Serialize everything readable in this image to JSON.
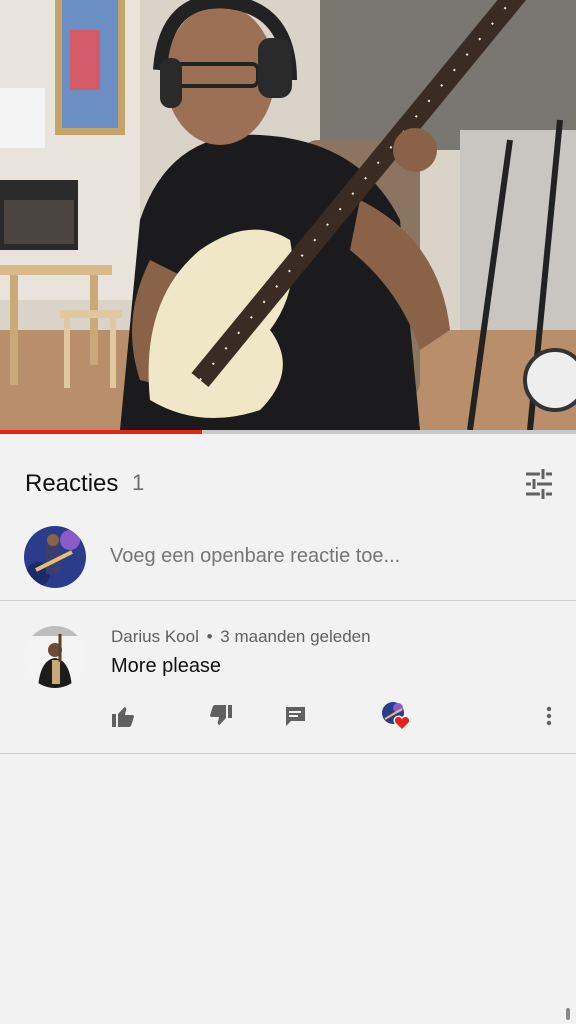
{
  "video": {
    "progress_fraction": 0.35,
    "accent_color": "#e62117"
  },
  "comments_header": {
    "title": "Reacties",
    "count": "1",
    "sort_icon": "sort-filter-icon"
  },
  "add_comment": {
    "placeholder": "Voeg een openbare reactie toe..."
  },
  "comments": [
    {
      "author": "Darius Kool",
      "separator": "•",
      "time": "3 maanden geleden",
      "text": "More please",
      "actions": {
        "like_icon": "thumb-up-icon",
        "dislike_icon": "thumb-down-icon",
        "reply_icon": "reply-comment-icon",
        "creator_heart_icon": "creator-heart-icon",
        "more_icon": "more-vert-icon"
      }
    }
  ]
}
